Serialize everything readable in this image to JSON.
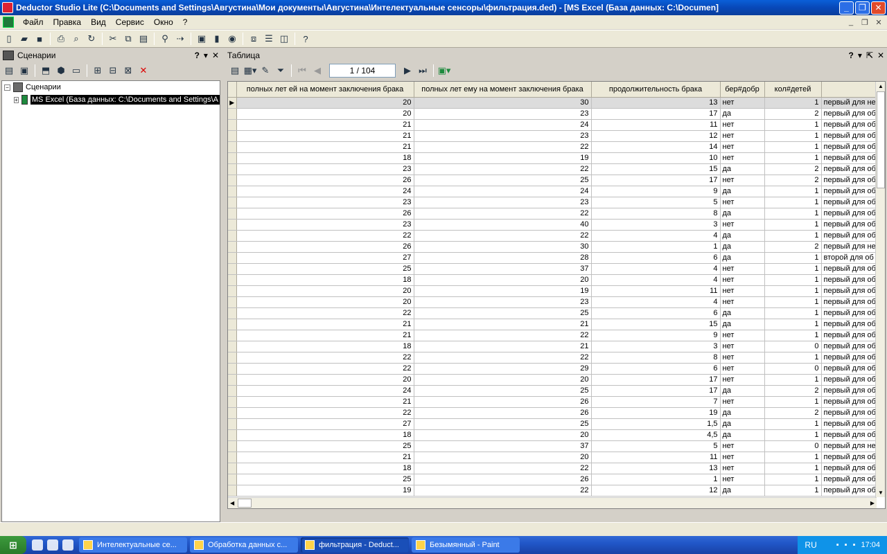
{
  "window": {
    "title": "Deductor Studio Lite (C:\\Documents and Settings\\Августина\\Мои документы\\Августина\\Интелектуальные сенсоры\\фильтрация.ded) - [MS Excel (База данных: C:\\Documen]"
  },
  "menu": [
    "Файл",
    "Правка",
    "Вид",
    "Сервис",
    "Окно",
    "?"
  ],
  "left_panel": {
    "title": "Сценарии",
    "tree": {
      "root": "Сценарии",
      "child": "MS Excel (База данных: C:\\Documents and Settings\\А"
    }
  },
  "right_panel": {
    "title": "Таблица",
    "pager": "1 / 104",
    "columns": [
      "полных лет ей на момент заключения брака",
      "полных лет ему на момент заключения брака",
      "продолжительность брака",
      "бер#добр",
      "кол#детей",
      ""
    ],
    "rows": [
      [
        "20",
        "30",
        "13",
        "нет",
        "1",
        "первый для не"
      ],
      [
        "20",
        "23",
        "17",
        "да",
        "2",
        "первый для об"
      ],
      [
        "21",
        "24",
        "11",
        "нет",
        "1",
        "первый для об"
      ],
      [
        "21",
        "23",
        "12",
        "нет",
        "1",
        "первый для об"
      ],
      [
        "21",
        "22",
        "14",
        "нет",
        "1",
        "первый для об"
      ],
      [
        "18",
        "19",
        "10",
        "нет",
        "1",
        "первый для об"
      ],
      [
        "23",
        "22",
        "15",
        "да",
        "2",
        "первый для об"
      ],
      [
        "26",
        "25",
        "17",
        "нет",
        "2",
        "первый для об"
      ],
      [
        "24",
        "24",
        "9",
        "да",
        "1",
        "первый для об"
      ],
      [
        "23",
        "23",
        "5",
        "нет",
        "1",
        "первый для об"
      ],
      [
        "26",
        "22",
        "8",
        "да",
        "1",
        "первый для об"
      ],
      [
        "23",
        "40",
        "3",
        "нет",
        "1",
        "первый для об"
      ],
      [
        "22",
        "22",
        "4",
        "да",
        "1",
        "первый для об"
      ],
      [
        "26",
        "30",
        "1",
        "да",
        "2",
        "первый для не"
      ],
      [
        "27",
        "28",
        "6",
        "да",
        "1",
        "второй для об"
      ],
      [
        "25",
        "37",
        "4",
        "нет",
        "1",
        "первый для об"
      ],
      [
        "18",
        "20",
        "4",
        "нет",
        "1",
        "первый для об"
      ],
      [
        "20",
        "19",
        "11",
        "нет",
        "1",
        "первый для об"
      ],
      [
        "20",
        "23",
        "4",
        "нет",
        "1",
        "первый для об"
      ],
      [
        "22",
        "25",
        "6",
        "да",
        "1",
        "первый для об"
      ],
      [
        "21",
        "21",
        "15",
        "да",
        "1",
        "первый для об"
      ],
      [
        "21",
        "22",
        "9",
        "нет",
        "1",
        "первый для об"
      ],
      [
        "18",
        "21",
        "3",
        "нет",
        "0",
        "первый для об"
      ],
      [
        "22",
        "22",
        "8",
        "нет",
        "1",
        "первый для об"
      ],
      [
        "22",
        "29",
        "6",
        "нет",
        "0",
        "первый для об"
      ],
      [
        "20",
        "20",
        "17",
        "нет",
        "1",
        "первый для об"
      ],
      [
        "24",
        "25",
        "17",
        "да",
        "2",
        "первый для об"
      ],
      [
        "21",
        "26",
        "7",
        "нет",
        "1",
        "первый для об"
      ],
      [
        "22",
        "26",
        "19",
        "да",
        "2",
        "первый для об"
      ],
      [
        "27",
        "25",
        "1,5",
        "да",
        "1",
        "первый для об"
      ],
      [
        "18",
        "20",
        "4,5",
        "да",
        "1",
        "первый для об"
      ],
      [
        "25",
        "37",
        "5",
        "нет",
        "0",
        "первый для не"
      ],
      [
        "21",
        "20",
        "11",
        "нет",
        "1",
        "первый для об"
      ],
      [
        "18",
        "22",
        "13",
        "нет",
        "1",
        "первый для об"
      ],
      [
        "25",
        "26",
        "1",
        "нет",
        "1",
        "первый для об"
      ],
      [
        "19",
        "22",
        "12",
        "да",
        "1",
        "первый для об"
      ]
    ]
  },
  "taskbar": {
    "tasks": [
      {
        "label": "Интелектуальные се...",
        "active": false
      },
      {
        "label": "Обработка данных с...",
        "active": false
      },
      {
        "label": "фильтрация - Deduct...",
        "active": true
      },
      {
        "label": "Безымянный - Paint",
        "active": false
      }
    ],
    "lang": "RU",
    "clock": "17:04"
  }
}
